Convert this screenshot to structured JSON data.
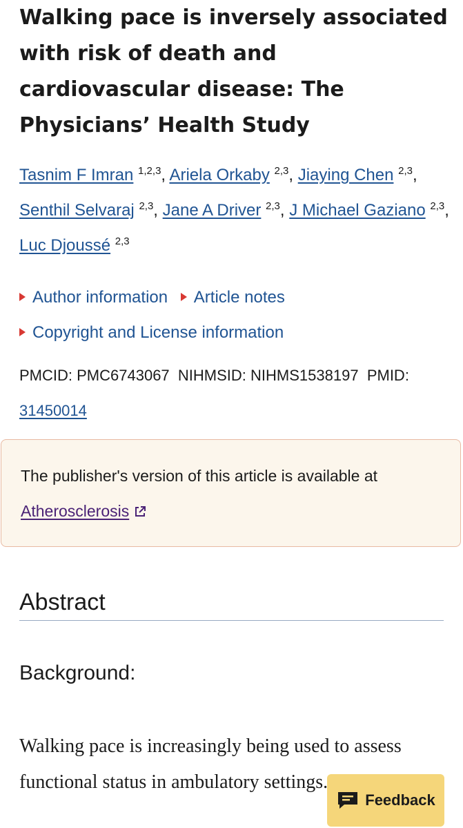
{
  "article": {
    "title": "Walking pace is inversely associated with risk of death and cardiovascular disease: The Physicians’ Health Study",
    "authors": [
      {
        "name": "Tasnim F Imran",
        "aff": "1,2,3",
        "sep": ", "
      },
      {
        "name": "Ariela Orkaby",
        "aff": "2,3",
        "sep": ", "
      },
      {
        "name": "Jiaying Chen",
        "aff": "2,3",
        "sep": ", "
      },
      {
        "name": "Senthil Selvaraj",
        "aff": "2,3",
        "sep": ", "
      },
      {
        "name": "Jane A Driver",
        "aff": "2,3",
        "sep": ", "
      },
      {
        "name": "J Michael Gaziano",
        "aff": "2,3",
        "sep": ", "
      },
      {
        "name": "Luc Djoussé",
        "aff": "2,3",
        "sep": ""
      }
    ],
    "toggles": {
      "author_information": "Author information",
      "article_notes": "Article notes",
      "copyright": "Copyright and License information"
    },
    "ids": {
      "pmcid_label": "PMCID:",
      "pmcid": "PMC6743067",
      "nihmsid_label": "NIHMSID:",
      "nihmsid": "NIHMS1538197",
      "pmid_label": "PMID:",
      "pmid": "31450014"
    }
  },
  "notice": {
    "text": "The publisher's version of this article is available at",
    "link": "Atherosclerosis"
  },
  "abstract": {
    "heading": "Abstract",
    "background_heading": "Background:",
    "background_text": "Walking pace is increasingly being used to assess functional status in ambulatory settings."
  },
  "feedback": {
    "label": "Feedback"
  },
  "colors": {
    "link": "#205493",
    "visited_link": "#4a2276",
    "toggle_marker": "#d83933",
    "notice_bg": "#fcf6ec",
    "feedback_bg": "#f5d67a"
  }
}
